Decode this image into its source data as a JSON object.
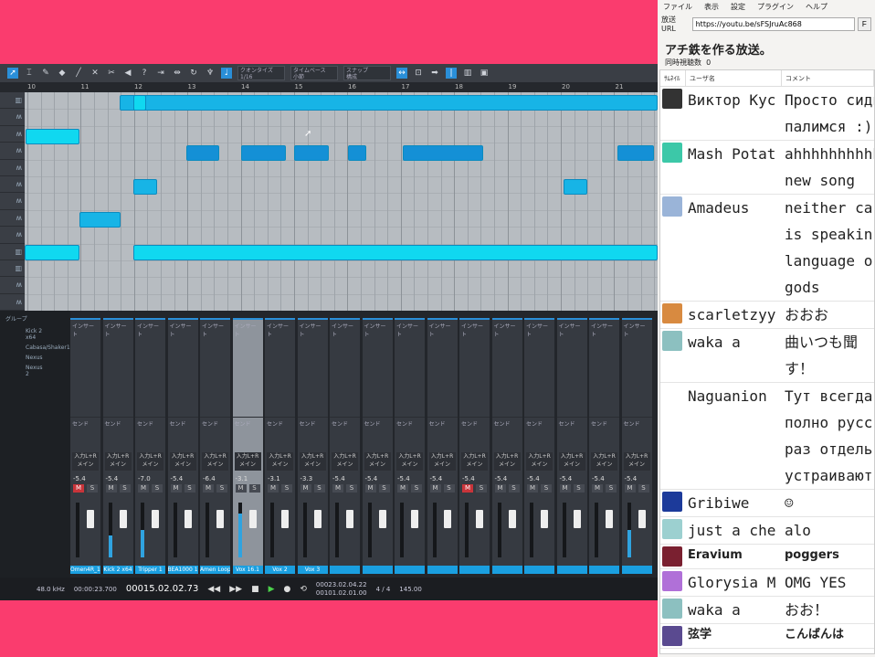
{
  "daw": {
    "toolbar": {
      "quantize_label": "クオンタイズ",
      "quantize_value": "1/16",
      "timebase_label": "タイムベース",
      "timebase_value": "小節",
      "snap_label": "スナップ",
      "snap_value": "構成"
    },
    "ruler": [
      "10",
      "11",
      "12",
      "13",
      "14",
      "15",
      "16",
      "17",
      "18",
      "19",
      "20",
      "21"
    ],
    "mixer": {
      "group_label": "グループ",
      "groups": [
        "Kick 2 x64",
        "Cabasa/Shaker1",
        "Nexus",
        "Nexus 2"
      ],
      "channels": [
        {
          "name": "Omen4R_16.1",
          "vol": "-5.4",
          "muted": true,
          "level": 0.0
        },
        {
          "name": "Kick 2 x64",
          "vol": "-5.4",
          "muted": false,
          "level": 0.4
        },
        {
          "name": "Tripper 1",
          "vol": "-7.0",
          "muted": false,
          "level": 0.5
        },
        {
          "name": "BEA1000 1.36",
          "vol": "-5.4",
          "muted": false,
          "level": 0.0
        },
        {
          "name": "Amen Loop 1",
          "vol": "-6.4",
          "muted": false,
          "level": 0.0
        },
        {
          "name": "Vox 16.1",
          "vol": "-3.1",
          "muted": false,
          "level": 0.8
        },
        {
          "name": "Vox 2",
          "vol": "-3.1",
          "muted": false,
          "level": 0.0
        },
        {
          "name": "Vox 3",
          "vol": "-3.3",
          "muted": false,
          "level": 0.0
        },
        {
          "name": "",
          "vol": "-5.4",
          "muted": false,
          "level": 0.0
        },
        {
          "name": "",
          "vol": "-5.4",
          "muted": false,
          "level": 0.0
        },
        {
          "name": "",
          "vol": "-5.4",
          "muted": false,
          "level": 0.0
        },
        {
          "name": "",
          "vol": "-5.4",
          "muted": false,
          "level": 0.0
        },
        {
          "name": "",
          "vol": "-5.4",
          "muted": true,
          "level": 0.0
        },
        {
          "name": "",
          "vol": "-5.4",
          "muted": false,
          "level": 0.0
        },
        {
          "name": "",
          "vol": "-5.4",
          "muted": false,
          "level": 0.0
        },
        {
          "name": "",
          "vol": "-5.4",
          "muted": false,
          "level": 0.0
        },
        {
          "name": "",
          "vol": "-5.4",
          "muted": false,
          "level": 0.0
        },
        {
          "name": "",
          "vol": "-5.4",
          "muted": false,
          "level": 0.5
        }
      ],
      "insert_label": "インサート",
      "send_label": "センド",
      "input_label": "入力L+R",
      "main_label": "メイン"
    },
    "transport": {
      "sample_rate": "48.0 kHz",
      "time": "00015.02.02.73",
      "secondary": "00:00:23.700",
      "loop_start": "00023.02.04.22",
      "loop_end": "00101.02.01.00",
      "tempo": "145.00",
      "signature": "4 / 4"
    }
  },
  "panel": {
    "menu": [
      "ファイル",
      "表示",
      "設定",
      "プラグイン",
      "ヘルプ"
    ],
    "url_label": "放送URL",
    "url_value": "https://youtu.be/sFSJruAc868",
    "f_button": "F",
    "title": "アチ鉄を作る放送。",
    "viewers_label": "同時視聴数",
    "viewers_value": "0",
    "columns": [
      "ｻﾑﾈｲﾙ",
      "ユーザ名",
      "コメント"
    ],
    "comments": [
      {
        "user": "Виктор Кус",
        "text": "Просто сиди\nпалимся :)",
        "color": "#333"
      },
      {
        "user": "Mash Potat",
        "text": "ahhhhhhhhhh\nnew song",
        "color": "#3cc8a8"
      },
      {
        "user": "Amadeus",
        "text": "neither ca\nis speakin\nlanguage o\ngods",
        "color": "#9ab4d8"
      },
      {
        "user": "scarletzyy",
        "text": "おおお",
        "color": "#d88a40"
      },
      {
        "user": "waka a",
        "text": "曲いつも聞\nす！",
        "color": "#8cc0c0"
      },
      {
        "user": "Naguanion",
        "text": "Тут всегда\nполно русс\nраз отдель\nустраивают",
        "color": "#fff"
      },
      {
        "user": "Gribiwe",
        "text": "☺",
        "color": "#1c3a9a"
      },
      {
        "user": "just a che",
        "text": "alo",
        "color": "#9cd0d0"
      },
      {
        "user": "Eravium",
        "text": "poggers",
        "color": "#7a2030",
        "small": true
      },
      {
        "user": "Glorysia M",
        "text": "OMG YES",
        "color": "#b070d8"
      },
      {
        "user": "waka a",
        "text": "おお！",
        "color": "#8cc0c0"
      },
      {
        "user": "弦学",
        "text": "こんばんは",
        "color": "#5a4a90",
        "small": true
      }
    ]
  }
}
